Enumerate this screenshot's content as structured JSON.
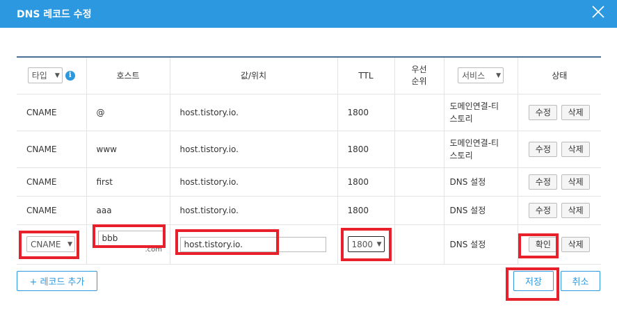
{
  "dialog": {
    "title": "DNS 레코드 수정"
  },
  "header": {
    "type_select": "타입",
    "info": "i",
    "host": "호스트",
    "value": "값/위치",
    "ttl": "TTL",
    "priority_line1": "우선",
    "priority_line2": "순위",
    "service_select": "서비스",
    "status": "상태"
  },
  "rows": [
    {
      "type": "CNAME",
      "host": "@",
      "value": "host.tistory.io.",
      "ttl": "1800",
      "service_line1": "도메인연결-티",
      "service_line2": "스토리",
      "edit": "수정",
      "delete": "삭제"
    },
    {
      "type": "CNAME",
      "host": "www",
      "value": "host.tistory.io.",
      "ttl": "1800",
      "service_line1": "도메인연결-티",
      "service_line2": "스토리",
      "edit": "수정",
      "delete": "삭제"
    },
    {
      "type": "CNAME",
      "host": "first",
      "value": "host.tistory.io.",
      "ttl": "1800",
      "service_line1": "DNS 설정",
      "service_line2": "",
      "edit": "수정",
      "delete": "삭제"
    },
    {
      "type": "CNAME",
      "host": "aaa",
      "value": "host.tistory.io.",
      "ttl": "1800",
      "service_line1": "DNS 설정",
      "service_line2": "",
      "edit": "수정",
      "delete": "삭제"
    }
  ],
  "edit_row": {
    "type": "CNAME",
    "host": "bbb",
    "host_suffix": ".com",
    "value": "host.tistory.io.",
    "ttl": "1800",
    "service": "DNS 설정",
    "confirm": "확인",
    "delete": "삭제"
  },
  "footer": {
    "add_record": "+ 레코드 추가",
    "save": "저장",
    "cancel": "취소"
  }
}
